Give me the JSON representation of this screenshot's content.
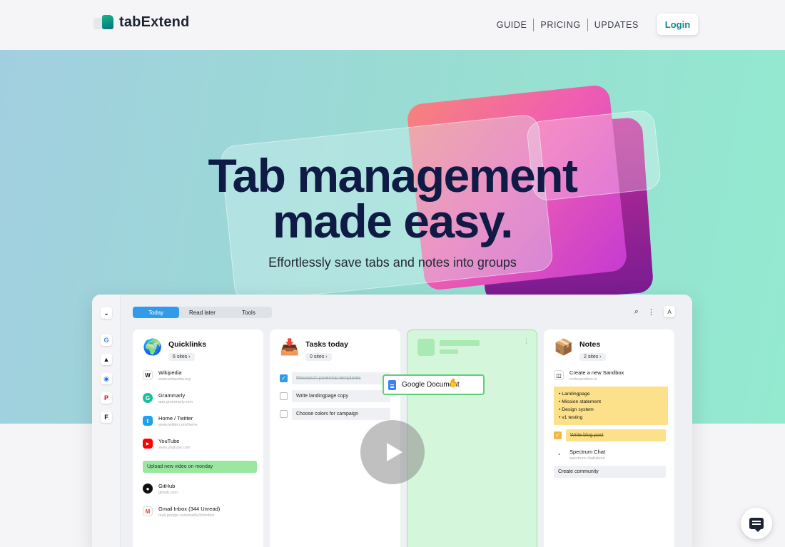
{
  "header": {
    "brand": "tabExtend",
    "nav": [
      "GUIDE",
      "PRICING",
      "UPDATES"
    ],
    "login_label": "Login"
  },
  "hero": {
    "title_line1": "Tab management",
    "title_line2": "made easy.",
    "subtitle": "Effortlessly save tabs and notes into groups"
  },
  "app": {
    "tabs": [
      "Today",
      "Read later",
      "Tools"
    ],
    "avatar_letter": "A",
    "rail_icons": [
      "chevron-down-icon",
      "google-icon",
      "drive-icon",
      "safari-icon",
      "pinterest-icon",
      "framer-icon"
    ],
    "quicklinks": {
      "title": "Quicklinks",
      "count": "6 sites ›",
      "items": [
        {
          "title": "Wikipedia",
          "url": "www.wikipedia.org",
          "icon": "W"
        },
        {
          "title": "Grammarly",
          "url": "app.grammarly.com",
          "icon": "G"
        },
        {
          "title": "Home / Twitter",
          "url": "www.twitter.com/home",
          "icon": "t"
        },
        {
          "title": "YouTube",
          "url": "www.youtube.com",
          "icon": "▶"
        }
      ],
      "note": "Upload new video on monday",
      "items2": [
        {
          "title": "GitHub",
          "url": "github.com",
          "icon": "●"
        },
        {
          "title": "Gmail Inbox (344 Unread)",
          "url": "mail.google.com/mail/u/0/#inbox",
          "icon": "M"
        }
      ]
    },
    "tasks": {
      "title": "Tasks today",
      "count": "0 sites ›",
      "items": [
        {
          "text": "Research potential templates",
          "done": true
        },
        {
          "text": "Write landingpage copy",
          "done": false
        },
        {
          "text": "Choose colors for campaign",
          "done": false
        }
      ]
    },
    "drag_card": {
      "label": "Google Document"
    },
    "notes": {
      "title": "Notes",
      "count": "2 sites ›",
      "item1": {
        "title": "Create a new Sandbox",
        "url": "codesandbox.io"
      },
      "note_lines": [
        "• Landingpage",
        "• Mission statement",
        "• Design system",
        "• v1 testing"
      ],
      "done_task": "Write blog post",
      "item2": {
        "title": "Spectrum Chat",
        "url": "spectrum.chat/about"
      },
      "task2": "Create community"
    }
  },
  "colors": {
    "accent": "#2f9bea",
    "brand_teal": "#0b8a8f",
    "title_navy": "#0f1a45"
  }
}
